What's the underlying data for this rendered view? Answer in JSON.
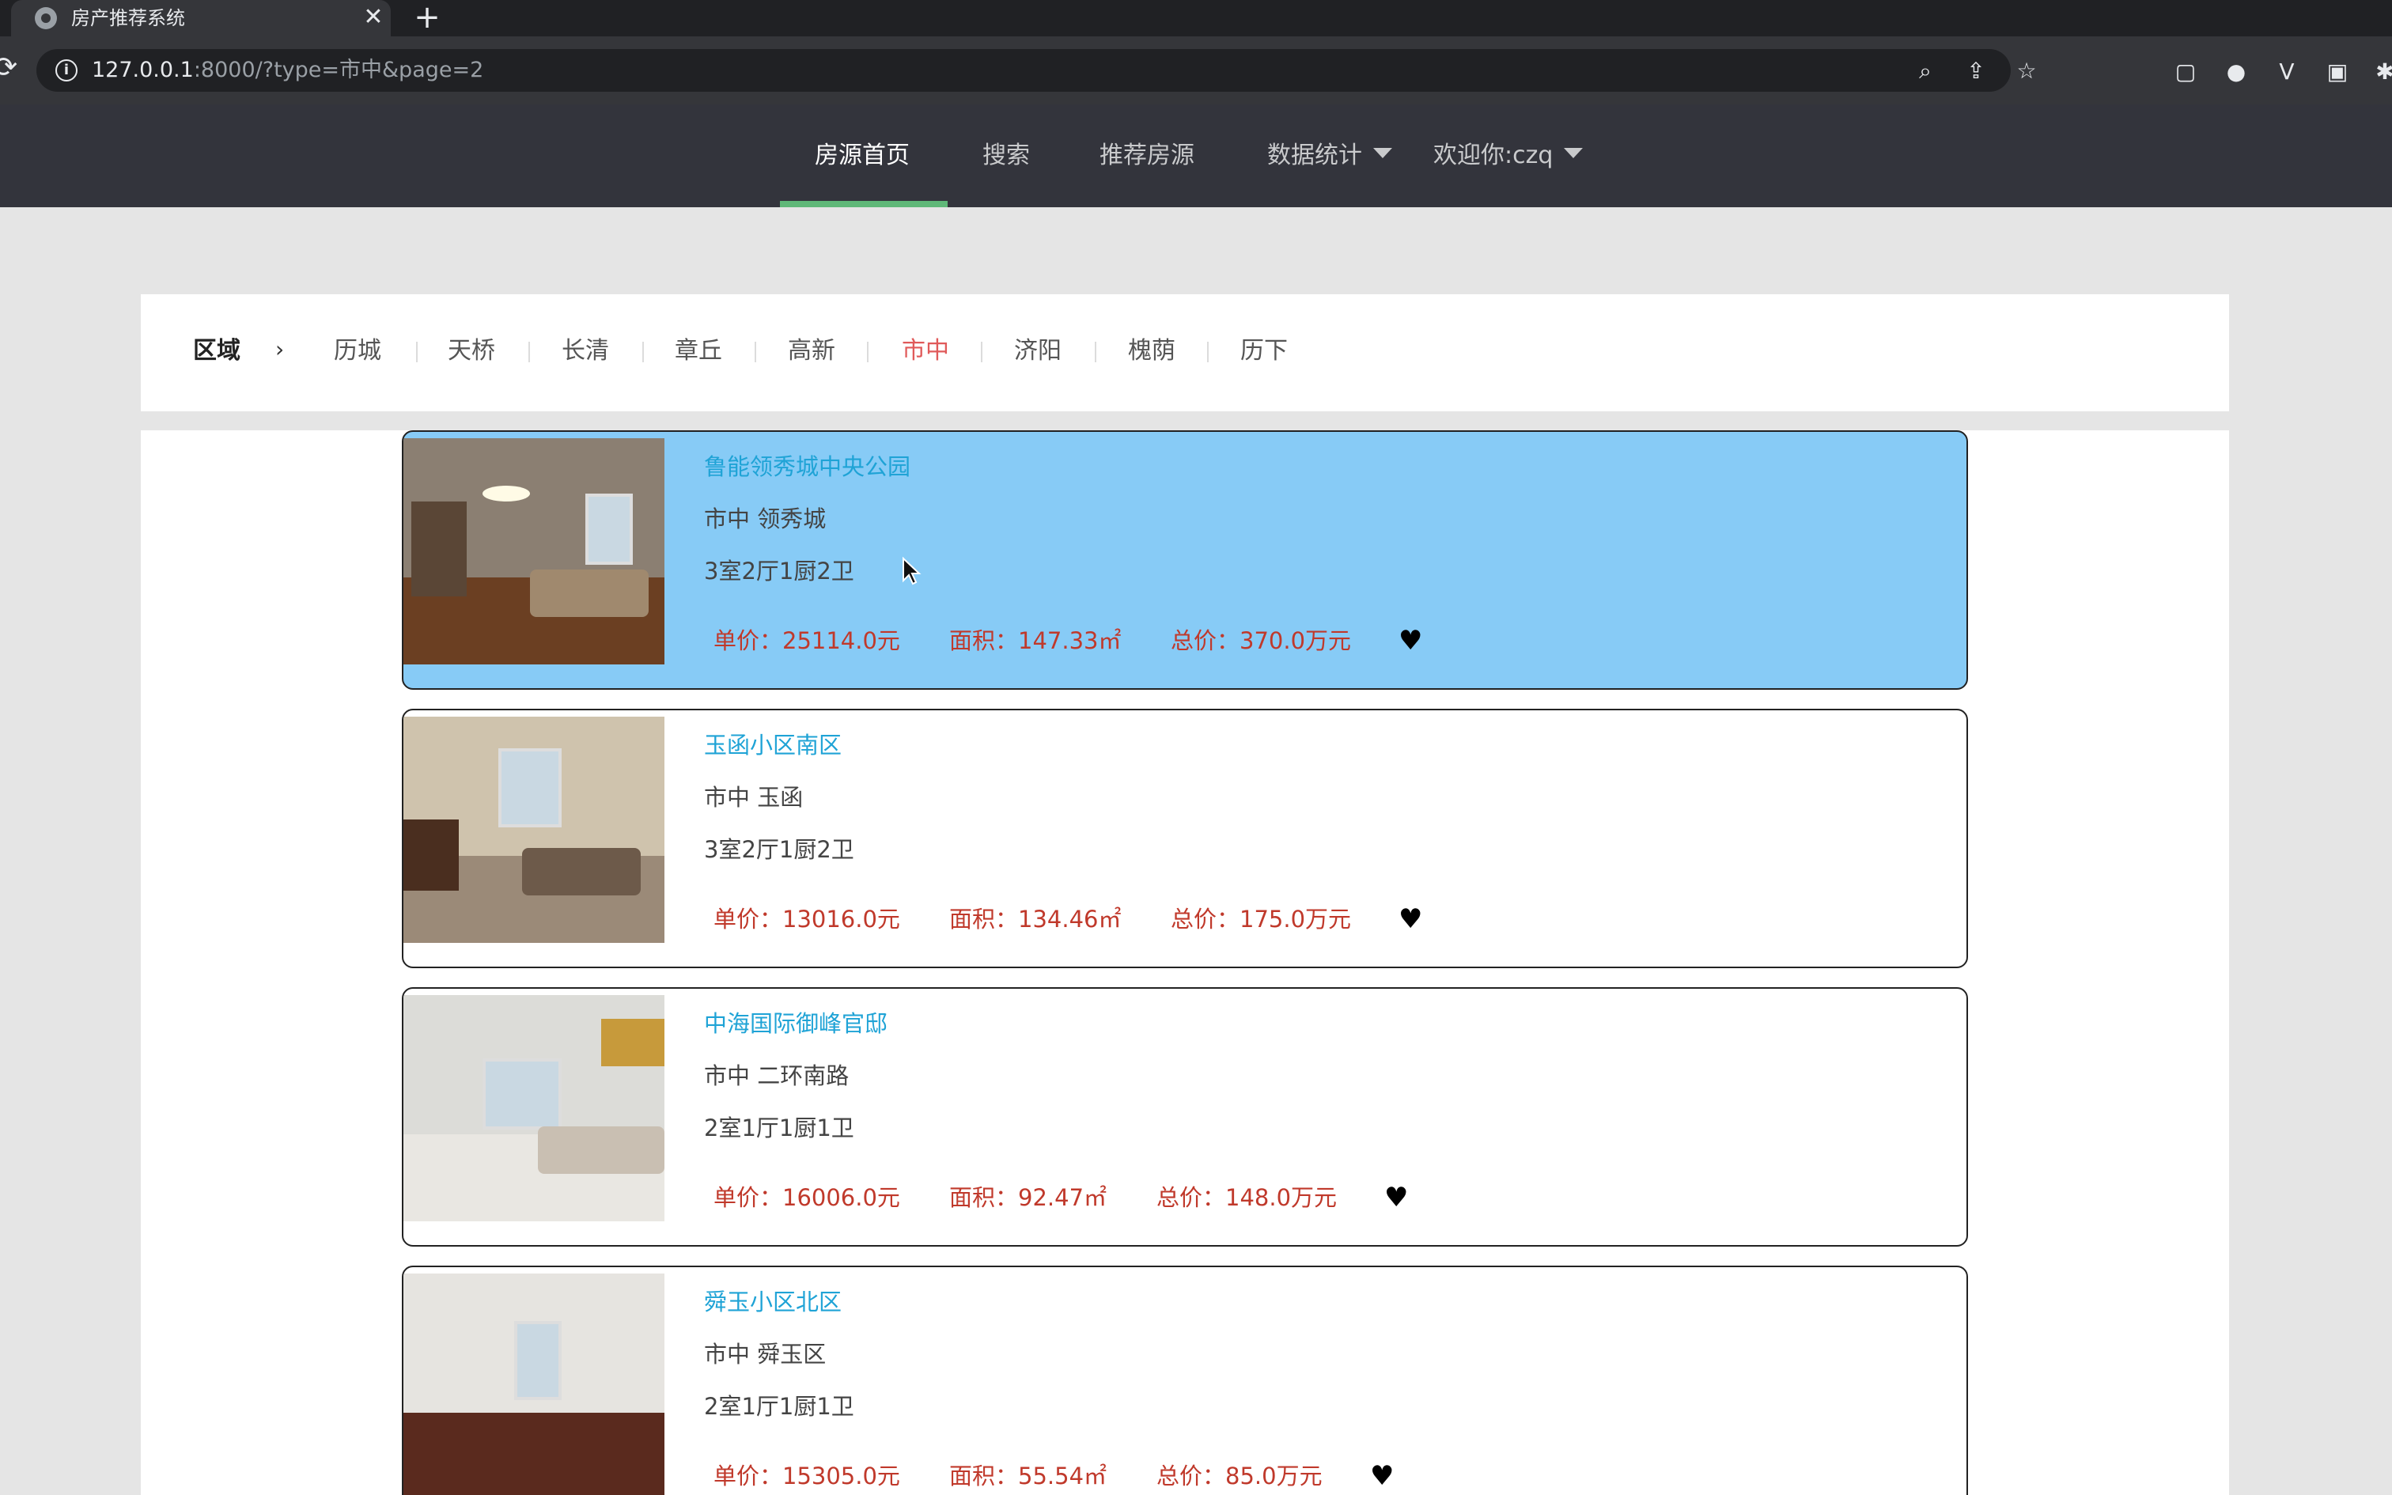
{
  "browser": {
    "tab_title": "房产推荐系统",
    "tab_close": "✕",
    "new_tab": "+",
    "url_host": "127.0.0.1",
    "url_rest": ":8000/?type=市中&page=2"
  },
  "navbar": {
    "items": [
      "房源首页",
      "搜索",
      "推荐房源",
      "数据统计",
      "欢迎你:czq"
    ],
    "active_index": 0,
    "accent_color": "#5fb878"
  },
  "filter": {
    "label": "区域",
    "arrow": "›",
    "regions": [
      "历城",
      "天桥",
      "长清",
      "章丘",
      "高新",
      "市中",
      "济阳",
      "槐荫",
      "历下"
    ],
    "active_region": "市中"
  },
  "listings": [
    {
      "title": "鲁能领秀城中央公园",
      "location": "市中 领秀城",
      "layout": "3室2厅1厨2卫",
      "unit_price": "单价：25114.0元",
      "area": "面积：147.33㎡",
      "total_price": "总价：370.0万元",
      "highlighted": true
    },
    {
      "title": "玉函小区南区",
      "location": "市中 玉函",
      "layout": "3室2厅1厨2卫",
      "unit_price": "单价：13016.0元",
      "area": "面积：134.46㎡",
      "total_price": "总价：175.0万元",
      "highlighted": false
    },
    {
      "title": "中海国际御峰官邸",
      "location": "市中 二环南路",
      "layout": "2室1厅1厨1卫",
      "unit_price": "单价：16006.0元",
      "area": "面积：92.47㎡",
      "total_price": "总价：148.0万元",
      "highlighted": false
    },
    {
      "title": "舜玉小区北区",
      "location": "市中 舜玉区",
      "layout": "2室1厅1厨1卫",
      "unit_price": "单价：15305.0元",
      "area": "面积：55.54㎡",
      "total_price": "总价：85.0万元",
      "highlighted": false
    }
  ],
  "colors": {
    "highlight_bg": "#87cbf6",
    "title_link": "#1fa3d6",
    "price_text": "#c0392b",
    "active_region": "#e05a5a"
  },
  "icons": {
    "heart": "heart-icon",
    "info": "info-icon",
    "reload": "reload-icon"
  }
}
